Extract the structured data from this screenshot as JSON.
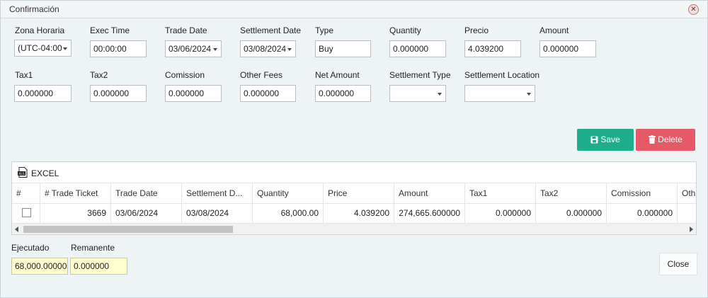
{
  "window": {
    "title": "Confirmación"
  },
  "form": {
    "zona_horaria": {
      "label": "Zona Horaria",
      "value": "(UTC-04:00"
    },
    "exec_time": {
      "label": "Exec Time",
      "value": "00:00:00"
    },
    "trade_date": {
      "label": "Trade Date",
      "value": "03/06/2024"
    },
    "settlement_date": {
      "label": "Settlement Date",
      "value": "03/08/2024"
    },
    "type": {
      "label": "Type",
      "value": "Buy"
    },
    "quantity": {
      "label": "Quantity",
      "value": "0.000000"
    },
    "precio": {
      "label": "Precio",
      "value": "4.039200"
    },
    "amount": {
      "label": "Amount",
      "value": "0.000000"
    },
    "tax1": {
      "label": "Tax1",
      "value": "0.000000"
    },
    "tax2": {
      "label": "Tax2",
      "value": "0.000000"
    },
    "comission": {
      "label": "Comission",
      "value": "0.000000"
    },
    "other_fees": {
      "label": "Other Fees",
      "value": "0.000000"
    },
    "net_amount": {
      "label": "Net Amount",
      "value": "0.000000"
    },
    "settlement_type": {
      "label": "Settlement Type",
      "value": ""
    },
    "settlement_location": {
      "label": "Settlement Location",
      "value": ""
    }
  },
  "actions": {
    "save_label": "Save",
    "delete_label": "Delete"
  },
  "grid": {
    "excel_label": "EXCEL",
    "columns": [
      "#",
      "# Trade Ticket",
      "Trade Date",
      "Settlement D...",
      "Quantity",
      "Price",
      "Amount",
      "Tax1",
      "Tax2",
      "Comission",
      "Oth"
    ],
    "rows": [
      {
        "trade_ticket": "3669",
        "trade_date": "03/06/2024",
        "settlement_date": "03/08/2024",
        "quantity": "68,000.00",
        "price": "4.039200",
        "amount": "274,665.600000",
        "tax1": "0.000000",
        "tax2": "0.000000",
        "comission": "0.000000",
        "other": ""
      }
    ]
  },
  "footer": {
    "ejecutado": {
      "label": "Ejecutado",
      "value": "68,000.000000"
    },
    "remanente": {
      "label": "Remanente",
      "value": "0.000000"
    },
    "close_label": "Close"
  },
  "colors": {
    "save": "#1fae8c",
    "delete": "#e55a67",
    "highlight": "#ffffcf"
  }
}
